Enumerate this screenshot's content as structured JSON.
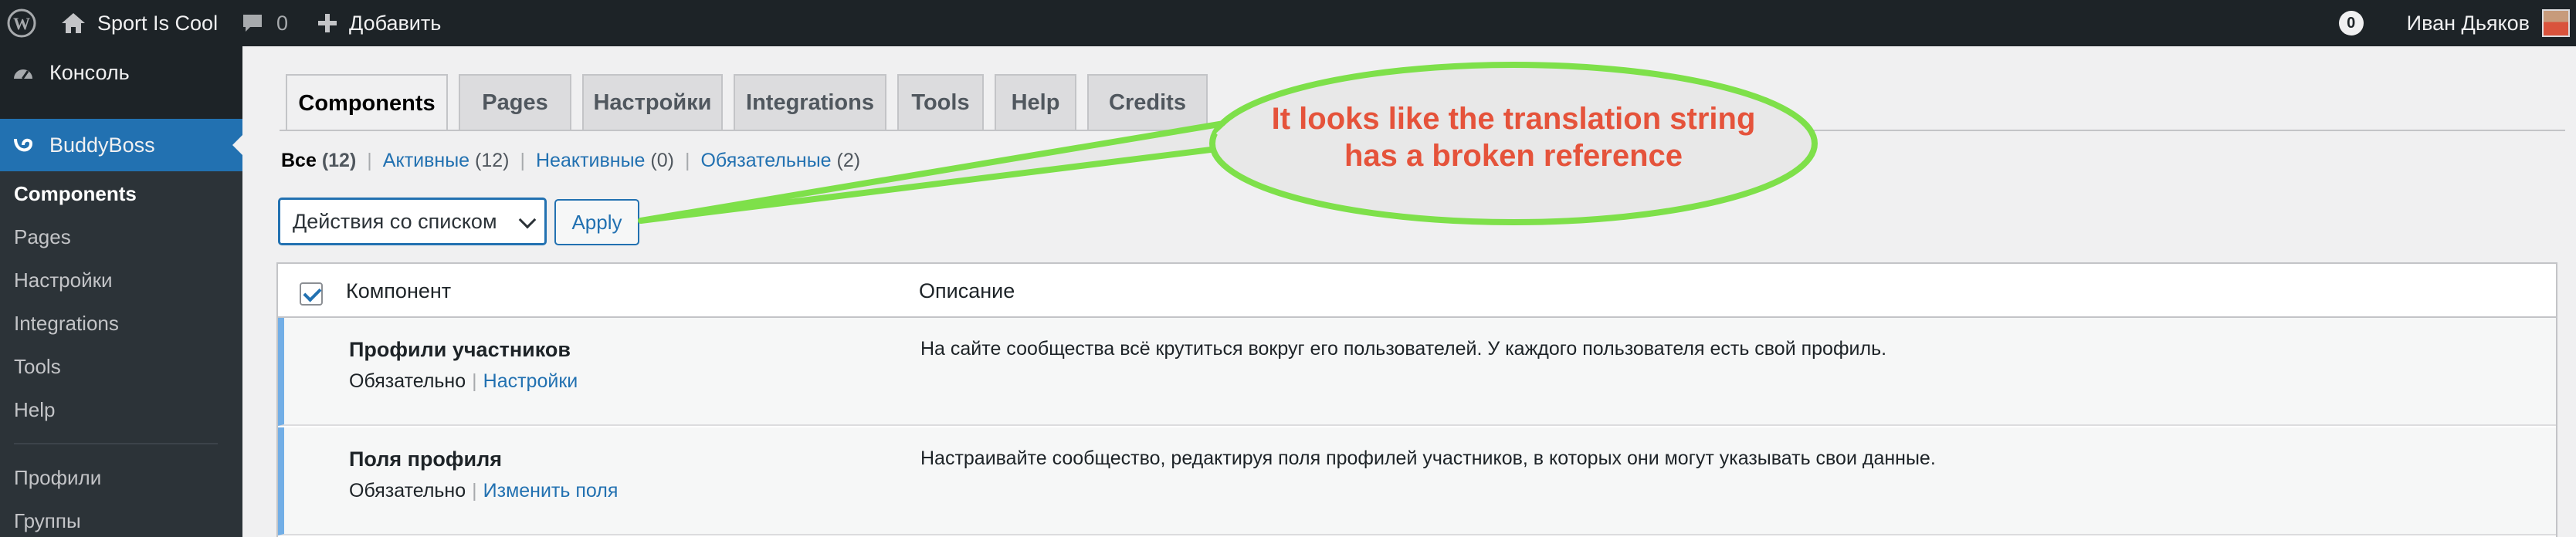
{
  "admin_bar": {
    "site_name": "Sport Is Cool",
    "comments_count": "0",
    "add_new": "Добавить",
    "notifications_count": "0",
    "user_name": "Иван Дьяков"
  },
  "sidebar": {
    "console": "Консоль",
    "buddyboss": "BuddyBoss",
    "submenu": [
      "Components",
      "Pages",
      "Настройки",
      "Integrations",
      "Tools",
      "Help"
    ],
    "after_sep": [
      "Профили",
      "Группы"
    ]
  },
  "tabs": [
    "Components",
    "Pages",
    "Настройки",
    "Integrations",
    "Tools",
    "Help",
    "Credits"
  ],
  "filters": [
    {
      "label": "Все",
      "count": "(12)"
    },
    {
      "label": "Активные",
      "count": "(12)"
    },
    {
      "label": "Неактивные",
      "count": "(0)"
    },
    {
      "label": "Обязательные",
      "count": "(2)"
    }
  ],
  "bulk": {
    "selected": "Действия со списком",
    "apply": "Apply"
  },
  "table": {
    "col_component": "Компонент",
    "col_description": "Описание",
    "rows": [
      {
        "title": "Профили участников",
        "status": "Обязательно",
        "action": "Настройки",
        "description": "На сайте сообщества всё крутиться вокруг его пользователей. У каждого пользователя есть свой профиль."
      },
      {
        "title": "Поля профиля",
        "status": "Обязательно",
        "action": "Изменить поля",
        "description": "Настраивайте сообщество, редактируя поля профилей участников, в которых они могут указывать свои данные."
      }
    ]
  },
  "annotation": {
    "line1": "It looks like the translation string",
    "line2": "has a broken reference",
    "stroke_color": "#7ee04a",
    "fill_color": "#e8e8e8",
    "text_color": "#e5533b"
  }
}
